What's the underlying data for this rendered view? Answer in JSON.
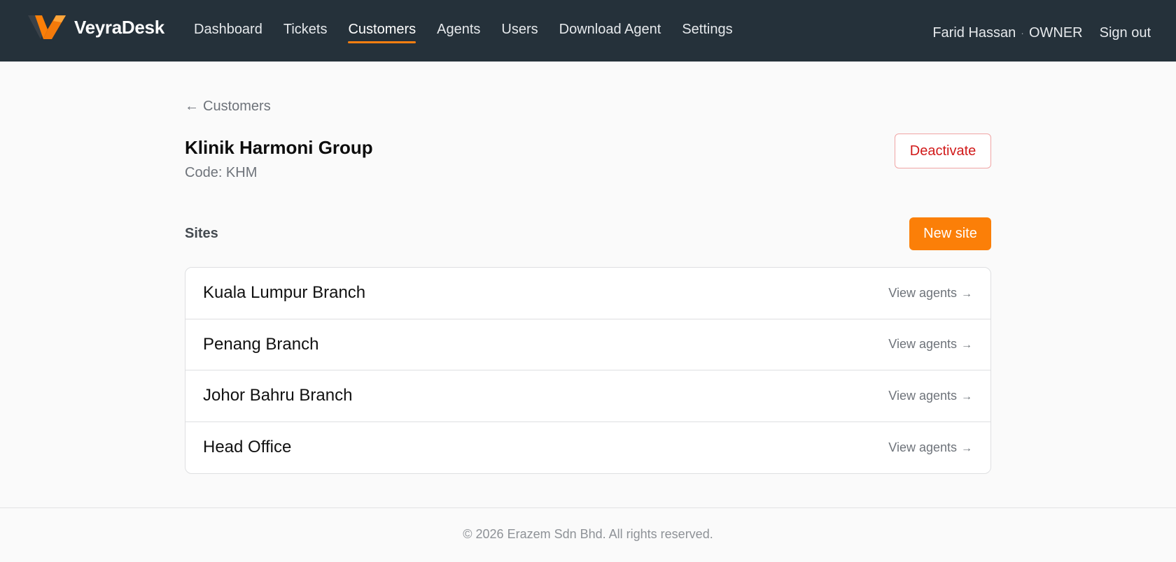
{
  "brand": {
    "name": "VeyraDesk",
    "logo_icon": "veyradesk-logo-icon"
  },
  "nav": {
    "items": [
      {
        "label": "Dashboard",
        "active": false
      },
      {
        "label": "Tickets",
        "active": false
      },
      {
        "label": "Customers",
        "active": true
      },
      {
        "label": "Agents",
        "active": false
      },
      {
        "label": "Users",
        "active": false
      },
      {
        "label": "Download Agent",
        "active": false
      },
      {
        "label": "Settings",
        "active": false
      }
    ]
  },
  "user": {
    "name": "Farid Hassan",
    "separator": "·",
    "role": "OWNER",
    "signout_label": "Sign out"
  },
  "breadcrumb": {
    "arrow": "←",
    "label": "Customers"
  },
  "customer": {
    "name": "Klinik Harmoni Group",
    "code_text": "Code: KHM"
  },
  "actions": {
    "deactivate_label": "Deactivate",
    "new_site_label": "New site"
  },
  "sites": {
    "heading": "Sites",
    "items": [
      {
        "name": "Kuala Lumpur Branch",
        "link": "View agents",
        "arrow": "→"
      },
      {
        "name": "Penang Branch",
        "link": "View agents",
        "arrow": "→"
      },
      {
        "name": "Johor Bahru Branch",
        "link": "View agents",
        "arrow": "→"
      },
      {
        "name": "Head Office",
        "link": "View agents",
        "arrow": "→"
      }
    ]
  },
  "footer": {
    "text": "© 2026 Erazem Sdn Bhd. All rights reserved."
  },
  "colors": {
    "topbar": "#25313a",
    "accent": "#fb7f08",
    "danger": "#d11a1a",
    "muted_text": "#6e737a"
  }
}
